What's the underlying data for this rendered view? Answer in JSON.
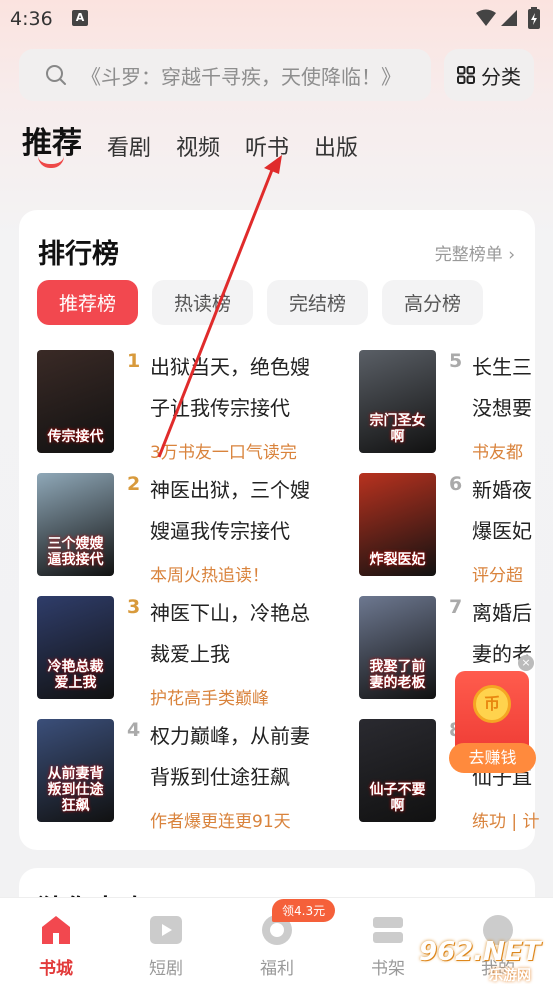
{
  "status": {
    "time": "4:36",
    "notif_icon": "A"
  },
  "search": {
    "placeholder": "《斗罗：穿越千寻疾，天使降临！》",
    "category_label": "分类"
  },
  "tabs": [
    {
      "label": "推荐",
      "active": true
    },
    {
      "label": "看剧",
      "active": false
    },
    {
      "label": "视频",
      "active": false
    },
    {
      "label": "听书",
      "active": false
    },
    {
      "label": "出版",
      "active": false
    }
  ],
  "ranking": {
    "title": "排行榜",
    "full_list": "完整榜单",
    "subtabs": [
      {
        "label": "推荐榜",
        "active": true
      },
      {
        "label": "热读榜",
        "active": false
      },
      {
        "label": "完结榜",
        "active": false
      },
      {
        "label": "高分榜",
        "active": false
      }
    ],
    "books": [
      {
        "rank": "1",
        "title_line1": "出狱当天，绝色嫂",
        "title_line2": "子让我传宗接代",
        "desc": "3万书友一口气读完",
        "cover_text": "传宗接代",
        "cover_color": "#3a2a26"
      },
      {
        "rank": "2",
        "title_line1": "神医出狱，三个嫂",
        "title_line2": "嫂逼我传宗接代",
        "desc": "本周火热追读！",
        "cover_text": "三个嫂嫂逼我接代",
        "cover_color": "#8fa8b8"
      },
      {
        "rank": "3",
        "title_line1": "神医下山，冷艳总",
        "title_line2": "裁爱上我",
        "desc": "护花高手类巅峰",
        "cover_text": "冷艳总裁爱上我",
        "cover_color": "#2f3d6a"
      },
      {
        "rank": "4",
        "title_line1": "权力巅峰，从前妻",
        "title_line2": "背叛到仕途狂飙",
        "desc": "作者爆更连更91天",
        "cover_text": "从前妻背叛到仕途狂飙",
        "cover_color": "#3b4f7a"
      },
      {
        "rank": "5",
        "title_line1": "长生三",
        "title_line2": "没想要",
        "desc": "书友都",
        "cover_text": "宗门圣女啊",
        "cover_color": "#5a5f66"
      },
      {
        "rank": "6",
        "title_line1": "新婚夜",
        "title_line2": "爆医妃",
        "desc": "评分超",
        "cover_text": "炸裂医妃",
        "cover_color": "#b8321f"
      },
      {
        "rank": "7",
        "title_line1": "离婚后",
        "title_line2": "妻的老",
        "desc": "",
        "cover_text": "我娶了前妻的老板",
        "cover_color": "#6d7890"
      },
      {
        "rank": "8",
        "title_line1": "",
        "title_line2": "仙子直",
        "desc": "练功 | 计",
        "cover_text": "仙子不要啊",
        "cover_color": "#2a2a30"
      }
    ]
  },
  "section2_title": "猜你喜欢",
  "float": {
    "earn_label": "去赚钱",
    "coin": "币"
  },
  "nav": [
    {
      "label": "书城",
      "active": true
    },
    {
      "label": "短剧",
      "active": false
    },
    {
      "label": "福利",
      "active": false
    },
    {
      "label": "书架",
      "active": false
    },
    {
      "label": "我的",
      "active": false
    }
  ],
  "nav_badge": "领4.3元",
  "watermark": {
    "line1": "962.NET",
    "line2": "乐游网"
  },
  "colors": {
    "accent": "#f2484f",
    "desc": "#d9833c",
    "arrow": "#e02b2b"
  }
}
